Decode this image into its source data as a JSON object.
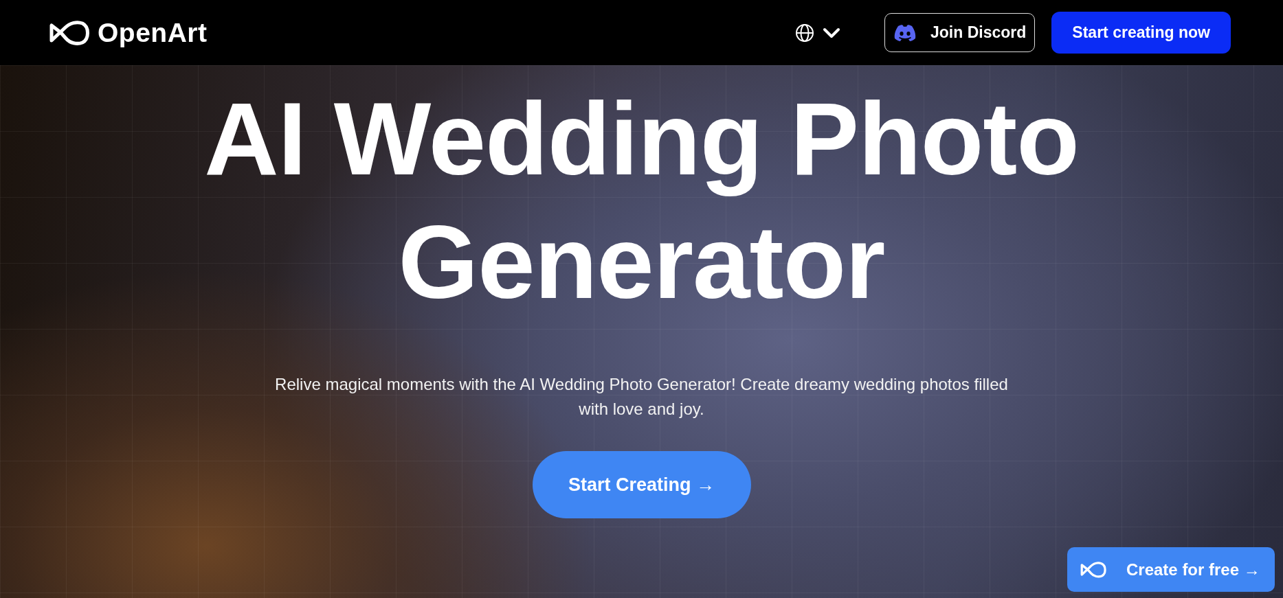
{
  "header": {
    "logo": "OpenArt",
    "language_menu": {
      "expanded": false
    },
    "buttons": [
      {
        "kind": "discord",
        "label": "Join Discord"
      },
      {
        "kind": "primary",
        "label": "Start creating now"
      }
    ]
  },
  "hero": {
    "title": "AI Wedding Photo Generator",
    "subtitle": "Relive magical moments with the AI Wedding Photo Generator! Create dreamy wedding photos filled with love and joy.",
    "cta": "Start Creating →"
  },
  "floating_button": {
    "label": "Create for free →"
  }
}
